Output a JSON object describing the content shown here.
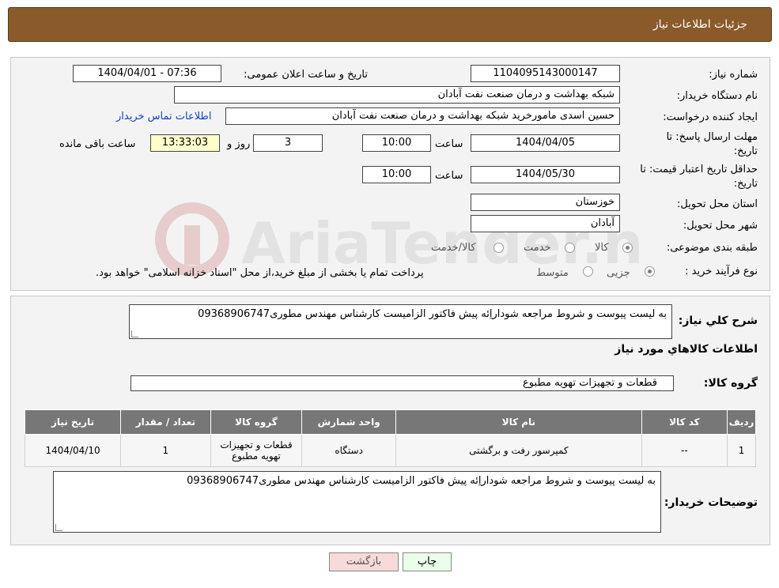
{
  "header": {
    "title": "جزئیات اطلاعات نیاز"
  },
  "details": {
    "need_number_label": "شماره نیاز:",
    "need_number": "1104095143000147",
    "announce_label": "تاریخ و ساعت اعلان عمومی:",
    "announce_value": "1404/04/01 - 07:36",
    "buyer_org_label": "نام دستگاه خریدار:",
    "buyer_org": "شبکه بهداشت و درمان صنعت نفت آبادان",
    "requester_label": "ایجاد کننده درخواست:",
    "requester": "حسین اسدی مامورخرید شبکه بهداشت و درمان صنعت نفت آبادان",
    "contact_link": "اطلاعات تماس خریدار",
    "reply_deadline_label": "مهلت ارسال پاسخ: تا تاریخ:",
    "reply_date": "1404/04/05",
    "time_label": "ساعت",
    "reply_time": "10:00",
    "days_value": "3",
    "days_label": "روز و",
    "remaining_time": "13:33:03",
    "remaining_label": "ساعت باقی مانده",
    "validity_label": "حداقل تاریخ اعتبار قیمت: تا تاریخ:",
    "validity_date": "1404/05/30",
    "validity_time": "10:00",
    "province_label": "استان محل تحویل:",
    "province": "خوزستان",
    "city_label": "شهر محل تحویل:",
    "city": "آبادان",
    "category_label": "طبقه بندی موضوعی:",
    "category_options": [
      "کالا",
      "خدمت",
      "کالا/خدمت"
    ],
    "category_selected": "کالا",
    "process_label": "نوع فرآیند خرید :",
    "process_options": [
      "جزیی",
      "متوسط"
    ],
    "process_selected": "جزیی",
    "process_note": "پرداخت تمام یا بخشی از مبلغ خرید،از محل \"اسناد خزانه اسلامی\" خواهد بود."
  },
  "summary": {
    "desc_label": "شرح کلي نیاز:",
    "desc_value": "به لیست پیوست و شروط مراجعه شوداراِئه پیش فاکتور الزامیست کارشناس مهندس مطوری09368906747",
    "goods_info_title": "اطلاعات کالاهاي مورد نیاز",
    "goods_group_label": "گروه کالا:",
    "goods_group": "قطعات و تجهیزات تهویه مطبوع"
  },
  "table": {
    "headers": [
      "ردیف",
      "کد کالا",
      "نام کالا",
      "واحد شمارش",
      "گروه کالا",
      "تعداد / مقدار",
      "تاریخ نیاز"
    ],
    "rows": [
      {
        "row": "1",
        "code": "--",
        "name": "کمپرسور رفت و برگشتی",
        "unit": "دستگاه",
        "group": "قطعات و تجهیزات تهویه مطبوع",
        "qty": "1",
        "date": "1404/04/10"
      }
    ]
  },
  "buyer_notes": {
    "label": "توضیحات خریدار:",
    "value": "به لیست پیوست و شروط مراجعه شوداراِئه پیش فاکتور الزامیست کارشناس مهندس مطوری09368906747"
  },
  "buttons": {
    "print": "چاپ",
    "back": "بازگشت"
  },
  "watermark": {
    "brand": "AriaTender.neT"
  },
  "colors": {
    "title_bar": "#8b5a2b",
    "link": "#1a3dc8",
    "table_header": "#777777",
    "back_button": "#f7dada",
    "print_button": "#eaffea"
  }
}
